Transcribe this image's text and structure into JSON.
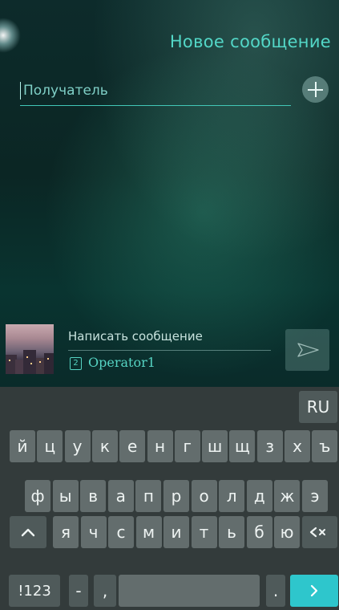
{
  "header": {
    "title": "Новое сообщение"
  },
  "recipient": {
    "placeholder": "Получатель"
  },
  "compose": {
    "placeholder": "Написать сообщение",
    "sim_slot": "2",
    "operator": "Operator1"
  },
  "keyboard": {
    "language": "RU",
    "row1": [
      "й",
      "ц",
      "у",
      "к",
      "е",
      "н",
      "г",
      "ш",
      "щ",
      "з",
      "х",
      "ъ"
    ],
    "row2": [
      "ф",
      "ы",
      "в",
      "а",
      "п",
      "р",
      "о",
      "л",
      "д",
      "ж",
      "э"
    ],
    "row3": [
      "я",
      "ч",
      "с",
      "м",
      "и",
      "т",
      "ь",
      "б",
      "ю"
    ],
    "symbols_label": "!123",
    "dash": "-",
    "comma": ",",
    "period": "."
  },
  "colors": {
    "accent": "#53d7c7",
    "enter": "#2ec6cc",
    "key": "#636d6d",
    "keyboard_bg": "#333b3b"
  },
  "icons": {
    "add_recipient": "plus-icon",
    "send": "send-icon",
    "shift": "shift-icon",
    "backspace": "backspace-icon",
    "enter": "arrow-right-icon"
  }
}
